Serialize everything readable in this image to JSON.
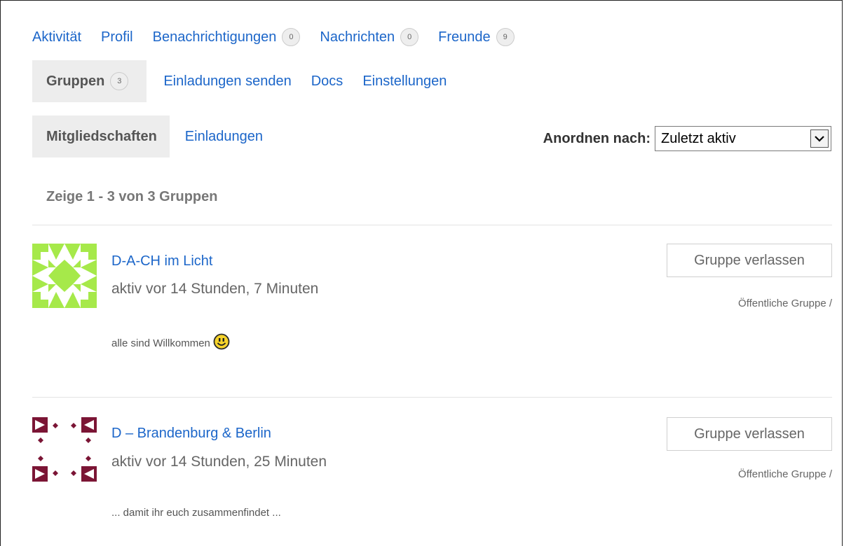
{
  "nav": {
    "row1": [
      {
        "label": "Aktivität"
      },
      {
        "label": "Profil"
      },
      {
        "label": "Benachrichtigungen",
        "count": "0"
      },
      {
        "label": "Nachrichten",
        "count": "0"
      },
      {
        "label": "Freunde",
        "count": "9"
      }
    ],
    "row2": [
      {
        "label": "Gruppen",
        "count": "3",
        "current": true
      },
      {
        "label": "Einladungen senden"
      },
      {
        "label": "Docs"
      },
      {
        "label": "Einstellungen"
      }
    ]
  },
  "subnav": {
    "items": [
      {
        "label": "Mitgliedschaften",
        "current": true
      },
      {
        "label": "Einladungen"
      }
    ],
    "order_label": "Anordnen nach:",
    "order_value": "Zuletzt aktiv"
  },
  "pagination": "Zeige 1 - 3 von 3 Gruppen",
  "groups": [
    {
      "title": "D-A-CH im Licht",
      "activity": "aktiv vor 14 Stunden, 7 Minuten",
      "description": "alle sind Willkommen",
      "leave_label": "Gruppe verlassen",
      "type": "Öffentliche Gruppe /",
      "avatar_color": "#a6e94a"
    },
    {
      "title": "D – Brandenburg & Berlin",
      "activity": "aktiv vor 14 Stunden, 25 Minuten",
      "description": "... damit ihr euch zusammenfindet ...",
      "leave_label": "Gruppe verlassen",
      "type": "Öffentliche Gruppe /",
      "avatar_color": "#7b1535"
    }
  ],
  "colors": {
    "link": "#1c66c9",
    "current_bg": "#ededed"
  }
}
